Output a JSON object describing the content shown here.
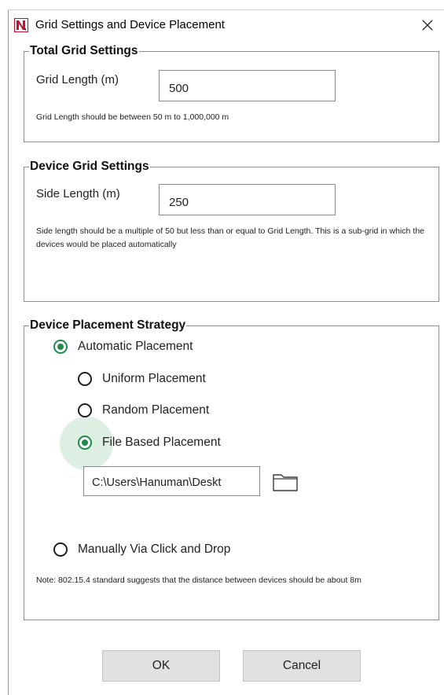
{
  "window": {
    "title": "Grid Settings and Device Placement",
    "close_glyph": "✕"
  },
  "total_grid": {
    "legend": "Total Grid Settings",
    "label": "Grid Length (m)",
    "value": "500",
    "hint": "Grid Length should be between 50 m to 1,000,000 m"
  },
  "device_grid": {
    "legend": "Device Grid Settings",
    "label": "Side Length (m)",
    "value": "250",
    "hint": "Side length should be a multiple of 50 but less than or equal to Grid Length. This is a sub-grid in which the devices would be placed automatically"
  },
  "placement": {
    "legend": "Device Placement Strategy",
    "automatic": {
      "label": "Automatic Placement",
      "checked": true
    },
    "uniform": {
      "label": "Uniform Placement",
      "checked": false
    },
    "random": {
      "label": "Random Placement",
      "checked": false
    },
    "file_based": {
      "label": "File Based Placement",
      "checked": true
    },
    "file_path": "C:\\Users\\Hanuman\\Deskt",
    "manual": {
      "label": "Manually Via Click and Drop",
      "checked": false
    },
    "note": "Note: 802.15.4 standard suggests that the distance between devices should be about 8m"
  },
  "buttons": {
    "ok": "OK",
    "cancel": "Cancel"
  },
  "icons": {
    "app": "netsim-app-icon",
    "close": "close-icon",
    "folder": "folder-icon"
  },
  "colors": {
    "radio_checked": "#1f8b4c",
    "ripple": "#ddeee3",
    "app_icon": "#c8102e",
    "button_bg": "#e1e1e1"
  }
}
